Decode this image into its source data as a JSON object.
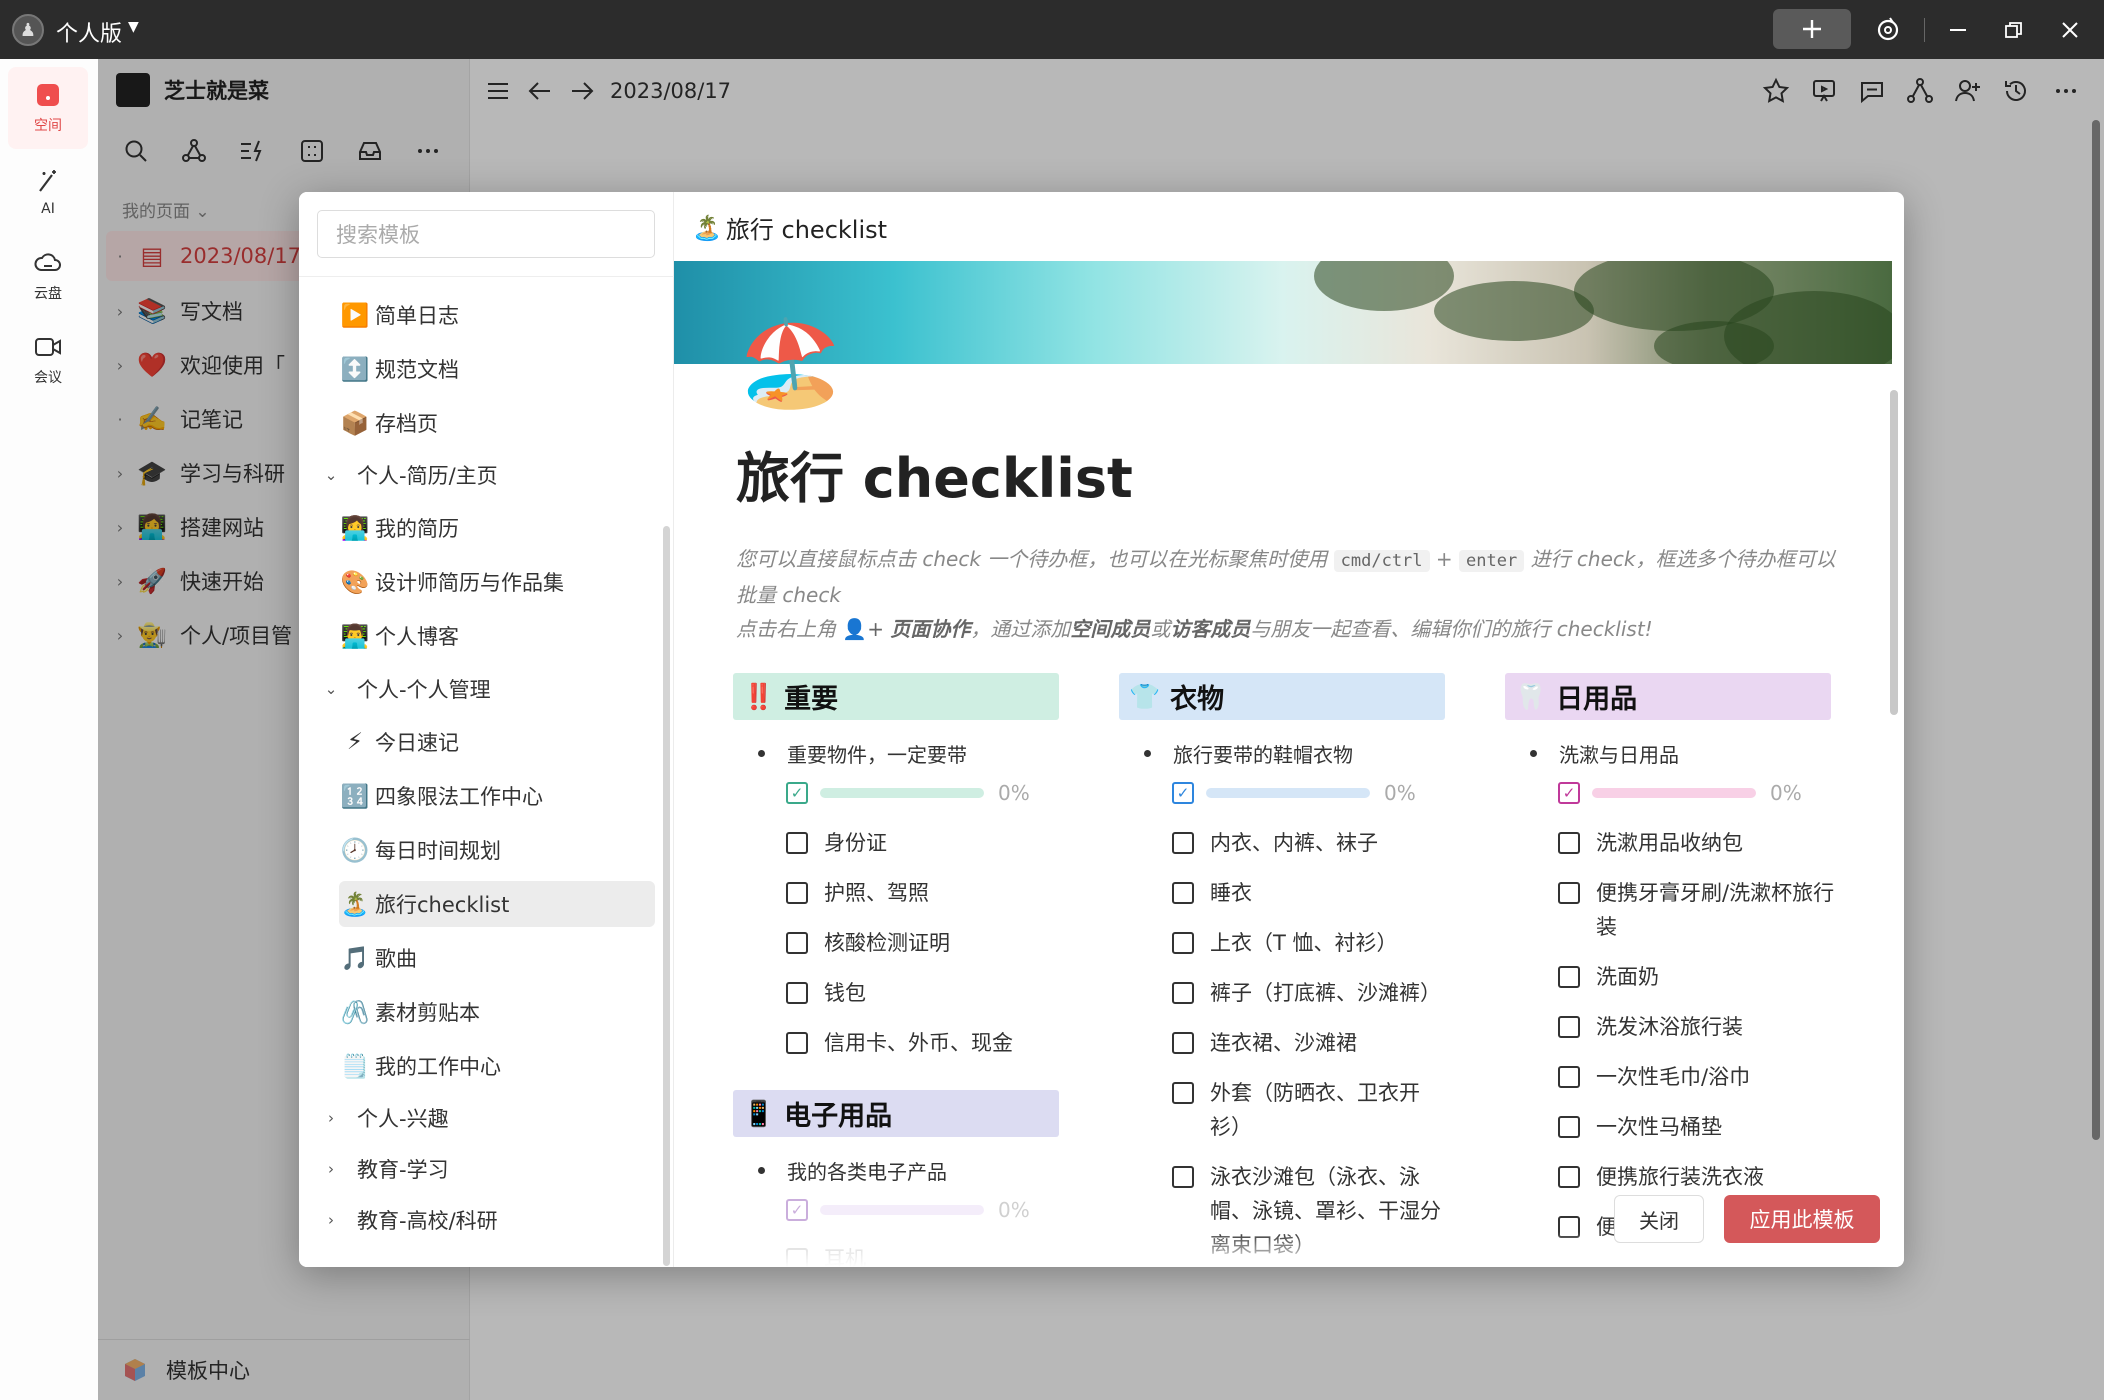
{
  "titlebar": {
    "label": "个人版",
    "avatar": "♟"
  },
  "rail": [
    {
      "label": "空间",
      "icon": "space-icon",
      "active": true
    },
    {
      "label": "AI",
      "icon": "ai-wand-icon"
    },
    {
      "label": "云盘",
      "icon": "cloud-icon"
    },
    {
      "label": "会议",
      "icon": "video-icon"
    }
  ],
  "sidebar": {
    "title": "芝士就是菜",
    "section": "我的页面 ⌄",
    "items": [
      {
        "arrow": "·",
        "emoji": "▤",
        "label": "2023/08/17"
      },
      {
        "arrow": "›",
        "emoji": "📚",
        "label": "写文档"
      },
      {
        "arrow": "›",
        "emoji": "❤️",
        "label": "欢迎使用「"
      },
      {
        "arrow": "·",
        "emoji": "✍️",
        "label": "记笔记"
      },
      {
        "arrow": "›",
        "emoji": "🎓",
        "label": "学习与科研"
      },
      {
        "arrow": "›",
        "emoji": "👩‍💻",
        "label": "搭建网站"
      },
      {
        "arrow": "›",
        "emoji": "🚀",
        "label": "快速开始"
      },
      {
        "arrow": "›",
        "emoji": "👨‍🌾",
        "label": "个人/项目管"
      }
    ],
    "bottom": "模板中心"
  },
  "main": {
    "date": "2023/08/17"
  },
  "modal": {
    "search_placeholder": "搜索模板",
    "templates": [
      {
        "emoji": "▶️",
        "label": "简单日志",
        "kind": "child"
      },
      {
        "emoji": "↕️",
        "label": "规范文档",
        "kind": "child"
      },
      {
        "emoji": "📦",
        "label": "存档页",
        "kind": "child"
      },
      {
        "arrow": "⌄",
        "label": "个人-简历/主页",
        "kind": "group"
      },
      {
        "emoji": "👩‍💻",
        "label": "我的简历",
        "kind": "child"
      },
      {
        "emoji": "🎨",
        "label": "设计师简历与作品集",
        "kind": "child"
      },
      {
        "emoji": "👨‍💻",
        "label": "个人博客",
        "kind": "child"
      },
      {
        "arrow": "⌄",
        "label": "个人-个人管理",
        "kind": "group"
      },
      {
        "emoji": "⚡",
        "label": "今日速记",
        "kind": "child"
      },
      {
        "emoji": "🔢",
        "label": "四象限法工作中心",
        "kind": "child"
      },
      {
        "emoji": "🕗",
        "label": "每日时间规划",
        "kind": "child"
      },
      {
        "emoji": "🏝️",
        "label": "旅行checklist",
        "kind": "child",
        "selected": true
      },
      {
        "emoji": "🎵",
        "label": "歌曲",
        "kind": "child"
      },
      {
        "emoji": "🖇️",
        "label": "素材剪贴本",
        "kind": "child"
      },
      {
        "emoji": "🗒️",
        "label": "我的工作中心",
        "kind": "child"
      },
      {
        "arrow": "›",
        "label": "个人-兴趣",
        "kind": "group"
      },
      {
        "arrow": "›",
        "label": "教育-学习",
        "kind": "group"
      },
      {
        "arrow": "›",
        "label": "教育-高校/科研",
        "kind": "group"
      }
    ],
    "preview": {
      "head_emoji": "🏝️",
      "head_title": "旅行 checklist",
      "page_icon": "🏖️",
      "page_title": "旅行 checklist",
      "desc1a": "您可以直接鼠标点击 check 一个待办框，也可以在光标聚焦时使用",
      "desc_code1": "cmd/ctrl",
      "desc_plus": "+",
      "desc_code2": "enter",
      "desc1b": "进行 check，框选多个待办框可以批量 check",
      "desc2a": "点击右上角",
      "desc2_icon": "👤+",
      "desc2b": "页面协作",
      "desc2c": "，通过添加",
      "desc2d": "空间成员",
      "desc2e": "或",
      "desc2f": "访客成员",
      "desc2g": "与朋友一起查看、编辑你们的旅行 checklist!",
      "columns": [
        {
          "emoji": "‼️",
          "title": "重要",
          "head_color": "#cfeee2",
          "bullet": "重要物件，一定要带",
          "progress": "0%",
          "bar_color": "#cfeee2",
          "cb_color": "#3aa98a",
          "tasks": [
            "身份证",
            "护照、驾照",
            "核酸检测证明",
            "钱包",
            "信用卡、外币、现金"
          ]
        },
        {
          "emoji": "👕",
          "title": "衣物",
          "head_color": "#d5e6f7",
          "bullet": "旅行要带的鞋帽衣物",
          "progress": "0%",
          "bar_color": "#d5e6f7",
          "cb_color": "#2e86de",
          "tasks": [
            "内衣、内裤、袜子",
            "睡衣",
            "上衣（T 恤、衬衫）",
            "裤子（打底裤、沙滩裤）",
            "连衣裙、沙滩裙",
            "外套（防晒衣、卫衣开衫）",
            "泳衣沙滩包（泳衣、泳帽、泳镜、罩衫、干湿分离束口袋）"
          ]
        },
        {
          "emoji": "🦷",
          "title": "日用品",
          "head_color": "#ead7f2",
          "bullet": "洗漱与日用品",
          "progress": "0%",
          "bar_color": "#f8d0e6",
          "cb_color": "#c0399a",
          "tasks": [
            "洗漱用品收纳包",
            "便携牙膏牙刷/洗漱杯旅行装",
            "洗面奶",
            "洗发沐浴旅行装",
            "一次性毛巾/浴巾",
            "一次性马桶垫",
            "便携旅行装洗衣液",
            "便携手"
          ]
        }
      ],
      "electronics": {
        "emoji": "📱",
        "title": "电子用品",
        "head_color": "#dcdcf2",
        "bullet": "我的各类电子产品",
        "progress": "0%",
        "bar_color": "#ece0f6",
        "cb_color": "#a06cc0",
        "partial_task": "耳机"
      }
    },
    "close": "关闭",
    "apply": "应用此模板"
  }
}
